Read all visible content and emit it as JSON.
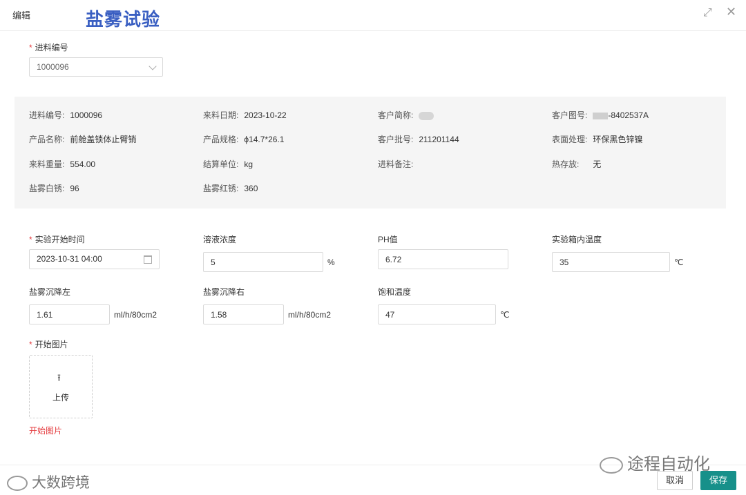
{
  "header": {
    "edit_label": "编辑",
    "title": "盐雾试验",
    "maximize_icon": "expand-icon",
    "close_icon": "close-icon"
  },
  "incoming": {
    "label": "进料编号",
    "value": "1000096"
  },
  "info": {
    "incoming_no": {
      "key": "进料编号:",
      "value": "1000096"
    },
    "incoming_date": {
      "key": "来料日期:",
      "value": "2023-10-22"
    },
    "customer_short": {
      "key": "客户简称:",
      "value": ""
    },
    "customer_drawing": {
      "key": "客户图号:",
      "value": "-8402537A"
    },
    "product_name": {
      "key": "产品名称:",
      "value": "前舱盖锁体止臂销"
    },
    "product_spec": {
      "key": "产品规格:",
      "value": "ϕ14.7*26.1"
    },
    "customer_batch": {
      "key": "客户批号:",
      "value": "211201144"
    },
    "surface": {
      "key": "表面处理:",
      "value": "环保黑色锌镍"
    },
    "incoming_weight": {
      "key": "来料重量:",
      "value": "554.00"
    },
    "settle_unit": {
      "key": "结算单位:",
      "value": "kg"
    },
    "incoming_note": {
      "key": "进料备注:",
      "value": ""
    },
    "heat_storage": {
      "key": "热存放:",
      "value": "无"
    },
    "salt_white": {
      "key": "盐雾白锈:",
      "value": "96"
    },
    "salt_red": {
      "key": "盐雾红锈:",
      "value": "360"
    }
  },
  "form": {
    "start_time": {
      "label": "实验开始时间",
      "value": "2023-10-31 04:00"
    },
    "concentration": {
      "label": "溶液浓度",
      "value": "5",
      "unit": "%"
    },
    "ph": {
      "label": "PH值",
      "value": "6.72"
    },
    "chamber_temp": {
      "label": "实验箱内温度",
      "value": "35",
      "unit": "℃"
    },
    "settle_left": {
      "label": "盐雾沉降左",
      "value": "1.61",
      "unit": "ml/h/80cm2"
    },
    "settle_right": {
      "label": "盐雾沉降右",
      "value": "1.58",
      "unit": "ml/h/80cm2"
    },
    "saturation_temp": {
      "label": "饱和温度",
      "value": "47",
      "unit": "℃"
    },
    "start_image": {
      "label": "开始图片",
      "upload_text": "上传",
      "error": "开始图片"
    }
  },
  "footer": {
    "cancel": "取消",
    "save": "保存"
  },
  "watermarks": {
    "left": "大数跨境",
    "right": "途程自动化"
  },
  "colors": {
    "title": "#3a5fc2",
    "primary": "#17908a",
    "required": "#e4393c"
  }
}
